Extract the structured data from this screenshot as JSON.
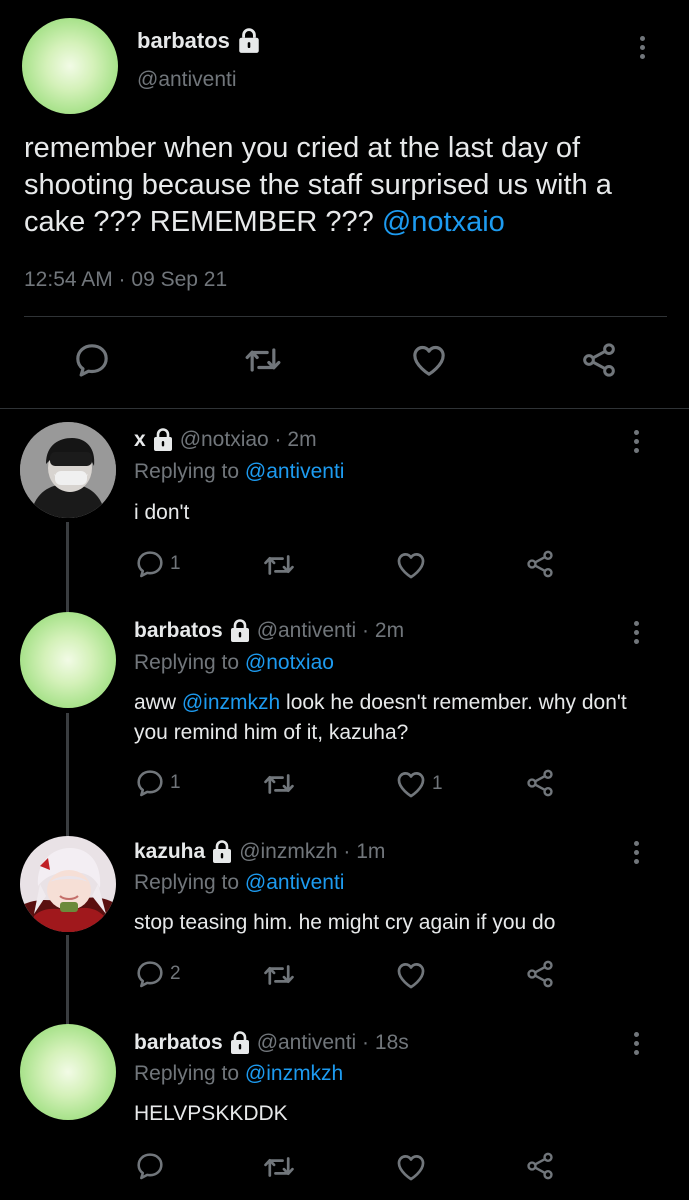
{
  "main": {
    "name": "barbatos",
    "handle": "@antiventi",
    "text_before": "remember when you cried at the last day of shooting because the staff surprised us with a cake ??? REMEMBER ??? ",
    "mention": "@notxaio",
    "timestamp": "12:54 AM · 09 Sep 21"
  },
  "replies": [
    {
      "name": "x",
      "handle": "@notxiao · 2m",
      "replying_label": "Replying to ",
      "replying_to": "@antiventi",
      "text": "i don't",
      "reply_count": "1",
      "like_count": ""
    },
    {
      "name": "barbatos",
      "handle": "@antiventi · 2m",
      "replying_label": "Replying to ",
      "replying_to": "@notxiao",
      "text_pre": "aww ",
      "text_mention": "@inzmkzh",
      "text_post": " look he doesn't remember. why don't you remind him of it, kazuha?",
      "reply_count": "1",
      "like_count": "1"
    },
    {
      "name": "kazuha",
      "handle": "@inzmkzh · 1m",
      "replying_label": "Replying to ",
      "replying_to": "@antiventi",
      "text": "stop teasing him. he might cry again if you do",
      "reply_count": "2",
      "like_count": ""
    },
    {
      "name": "barbatos",
      "handle": "@antiventi · 18s",
      "replying_label": "Replying to ",
      "replying_to": "@inzmkzh",
      "text": "HELVPSKKDDK",
      "reply_count": "",
      "like_count": ""
    }
  ],
  "icons": {
    "reply": "reply-icon",
    "retweet": "retweet-icon",
    "like": "heart-icon",
    "share": "share-icon",
    "more": "more-vertical-icon",
    "lock": "lock-icon"
  },
  "colors": {
    "background": "#000000",
    "text": "#e7e9ea",
    "muted": "#71767b",
    "link": "#1d9bf0",
    "divider": "#2f3336"
  }
}
